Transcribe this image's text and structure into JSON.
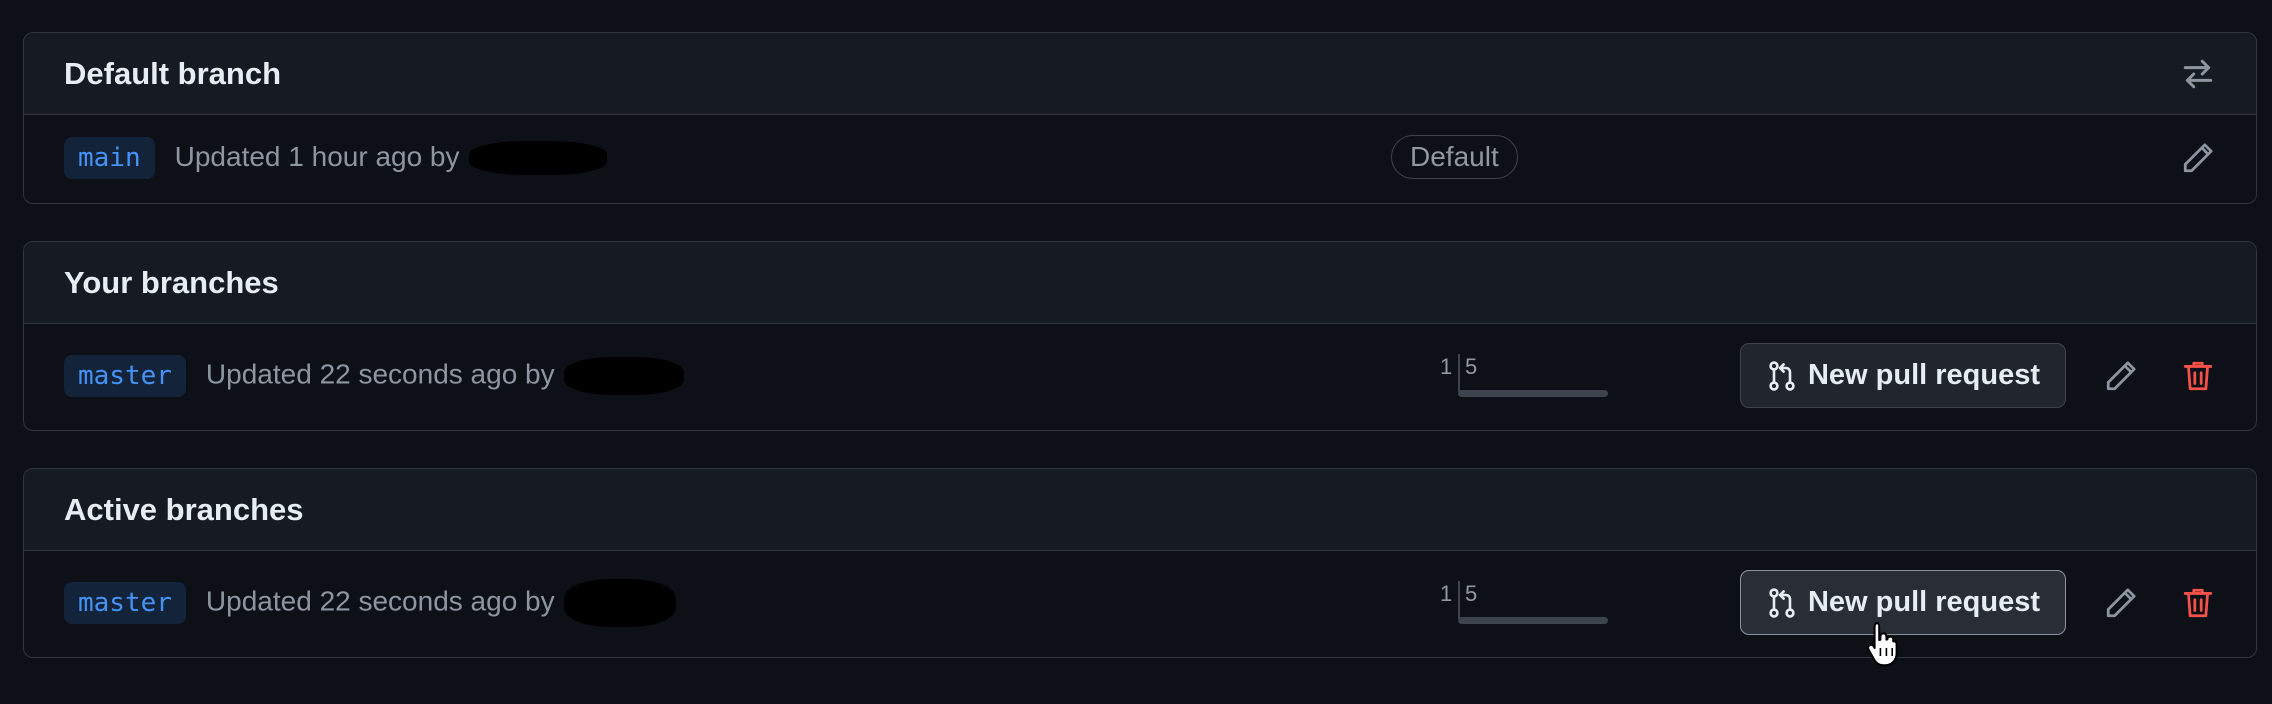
{
  "default_section": {
    "title": "Default branch",
    "branch": "main",
    "meta": "Updated 1 hour ago by",
    "badge": "Default"
  },
  "your_section": {
    "title": "Your branches",
    "branch": "master",
    "meta": "Updated 22 seconds ago by",
    "behind": "1",
    "ahead": "5",
    "pr_label": "New pull request"
  },
  "active_section": {
    "title": "Active branches",
    "branch": "master",
    "meta": "Updated 22 seconds ago by",
    "behind": "1",
    "ahead": "5",
    "pr_label": "New pull request"
  },
  "colors": {
    "accent": "#4493f8",
    "danger": "#f85149",
    "muted": "#8d96a0"
  },
  "icons": [
    "switch-branch-icon",
    "pencil-icon",
    "trash-icon",
    "git-pull-request-icon",
    "hand-cursor-icon"
  ]
}
